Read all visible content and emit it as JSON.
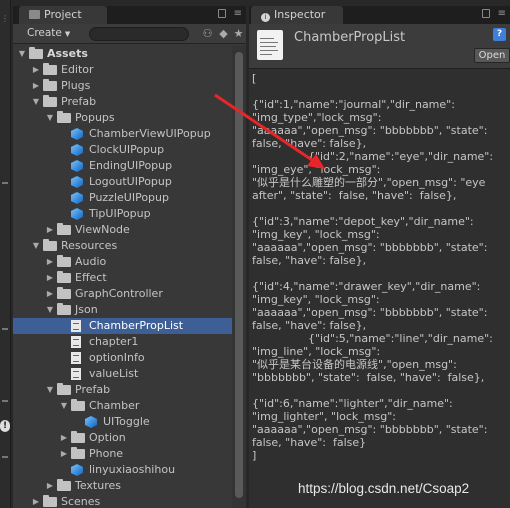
{
  "project": {
    "tab_label": "Project",
    "create_label": "Create",
    "tree": [
      {
        "label": "Assets",
        "depth": 0,
        "kind": "folder",
        "expanded": true,
        "bold": true
      },
      {
        "label": "Editor",
        "depth": 1,
        "kind": "folder",
        "expanded": false
      },
      {
        "label": "Plugs",
        "depth": 1,
        "kind": "folder",
        "expanded": false
      },
      {
        "label": "Prefab",
        "depth": 1,
        "kind": "folder",
        "expanded": true
      },
      {
        "label": "Popups",
        "depth": 2,
        "kind": "folder",
        "expanded": true
      },
      {
        "label": "ChamberViewUIPopup",
        "depth": 3,
        "kind": "prefab"
      },
      {
        "label": "ClockUIPopup",
        "depth": 3,
        "kind": "prefab"
      },
      {
        "label": "EndingUIPopup",
        "depth": 3,
        "kind": "prefab"
      },
      {
        "label": "LogoutUIPopup",
        "depth": 3,
        "kind": "prefab"
      },
      {
        "label": "PuzzleUIPopup",
        "depth": 3,
        "kind": "prefab"
      },
      {
        "label": "TipUIPopup",
        "depth": 3,
        "kind": "prefab"
      },
      {
        "label": "ViewNode",
        "depth": 2,
        "kind": "folder",
        "expanded": false
      },
      {
        "label": "Resources",
        "depth": 1,
        "kind": "folder",
        "expanded": true
      },
      {
        "label": "Audio",
        "depth": 2,
        "kind": "folder",
        "expanded": false
      },
      {
        "label": "Effect",
        "depth": 2,
        "kind": "folder",
        "expanded": false
      },
      {
        "label": "GraphController",
        "depth": 2,
        "kind": "folder",
        "expanded": false
      },
      {
        "label": "Json",
        "depth": 2,
        "kind": "folder",
        "expanded": true
      },
      {
        "label": "ChamberPropList",
        "depth": 3,
        "kind": "doc",
        "selected": true
      },
      {
        "label": "chapter1",
        "depth": 3,
        "kind": "doc"
      },
      {
        "label": "optionInfo",
        "depth": 3,
        "kind": "doc"
      },
      {
        "label": "valueList",
        "depth": 3,
        "kind": "doc"
      },
      {
        "label": "Prefab",
        "depth": 2,
        "kind": "folder",
        "expanded": true
      },
      {
        "label": "Chamber",
        "depth": 3,
        "kind": "folder",
        "expanded": true
      },
      {
        "label": "UIToggle",
        "depth": 4,
        "kind": "prefab"
      },
      {
        "label": "Option",
        "depth": 3,
        "kind": "folder",
        "expanded": false
      },
      {
        "label": "Phone",
        "depth": 3,
        "kind": "folder",
        "expanded": false
      },
      {
        "label": "linyuxiaoshihou",
        "depth": 3,
        "kind": "prefab"
      },
      {
        "label": "Textures",
        "depth": 2,
        "kind": "folder",
        "expanded": false
      },
      {
        "label": "Scenes",
        "depth": 1,
        "kind": "folder",
        "expanded": false
      }
    ]
  },
  "inspector": {
    "tab_label": "Inspector",
    "asset_title": "ChamberPropList",
    "open_label": "Open",
    "help_label": "?",
    "json_lines": [
      "[",
      "",
      "{\"id\":1,\"name\":\"journal\",\"dir_name\":",
      "\"img_type\",\"lock_msg\":",
      "\"aaaaaa\",\"open_msg\": \"bbbbbbb\", \"state\":",
      "false, \"have\": false},",
      "                {\"id\":2,\"name\":\"eye\",\"dir_name\":",
      "\"img_eye\", \"lock_msg\":",
      "\"似乎是什么雕塑的一部分\",\"open_msg\": \"eye",
      "after\", \"state\":  false, \"have\":  false},",
      "",
      "{\"id\":3,\"name\":\"depot_key\",\"dir_name\":",
      "\"img_key\", \"lock_msg\":",
      "\"aaaaaa\",\"open_msg\": \"bbbbbbb\", \"state\":",
      "false, \"have\": false},",
      "",
      "{\"id\":4,\"name\":\"drawer_key\",\"dir_name\":",
      "\"img_key\", \"lock_msg\":",
      "\"aaaaaa\",\"open_msg\": \"bbbbbbb\", \"state\":",
      "false, \"have\": false},",
      "                {\"id\":5,\"name\":\"line\",\"dir_name\":",
      "\"img_line\", \"lock_msg\":",
      "\"似乎是某台设备的电源线\",\"open_msg\":",
      "\"bbbbbbb\", \"state\":  false, \"have\":  false},",
      "",
      "{\"id\":6,\"name\":\"lighter\",\"dir_name\":",
      "\"img_lighter\", \"lock_msg\":",
      "\"aaaaaa\",\"open_msg\": \"bbbbbbb\", \"state\":",
      "false, \"have\":  false}",
      "]"
    ]
  },
  "watermark": "https://blog.csdn.net/Csoap2",
  "colors": {
    "selection": "#3e5f96",
    "annotation_arrow": "#e8262a",
    "prefab_icon": "#3a8fe0"
  },
  "icons": [
    "tab-menu-icon",
    "lock-icon",
    "search-icon",
    "filter-icon",
    "star-icon",
    "help-icon",
    "folder-icon",
    "prefab-cube-icon",
    "text-asset-icon"
  ]
}
